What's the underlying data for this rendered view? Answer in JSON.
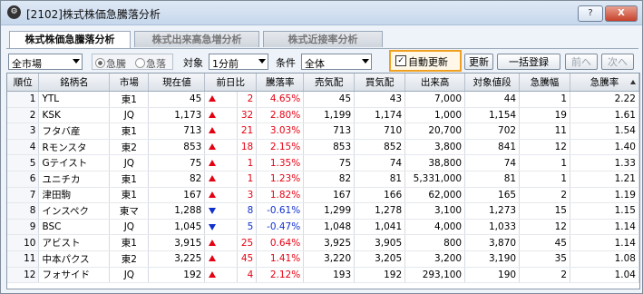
{
  "window": {
    "title": "[2102]株式株価急騰落分析",
    "help_label": "?",
    "close_label": "X"
  },
  "tabs": [
    {
      "label": "株式株価急騰落分析",
      "active": true
    },
    {
      "label": "株式出来高急増分析",
      "active": false
    },
    {
      "label": "株式近接率分析",
      "active": false
    }
  ],
  "toolbar": {
    "market_select": "全市場",
    "radio_rise": "急騰",
    "radio_fall": "急落",
    "target_label": "対象",
    "target_select": "1分前",
    "condition_label": "条件",
    "condition_select": "全体",
    "auto_update_label": "自動更新",
    "auto_update_checked": true,
    "update_button": "更新",
    "register_all_button": "一括登録",
    "prev_button": "前へ",
    "next_button": "次へ"
  },
  "table": {
    "headers": [
      "順位",
      "銘柄名",
      "市場",
      "現在値",
      "前日比",
      "",
      "騰落率",
      "売気配",
      "買気配",
      "出来高",
      "対象値段",
      "急騰幅",
      "急騰率"
    ],
    "rows": [
      {
        "rank": "1",
        "name": "YTL",
        "market": "東1",
        "price": "45",
        "dir": "up",
        "change": "2",
        "rate": "4.65%",
        "ask": "45",
        "bid": "43",
        "volume": "7,000",
        "target_price": "44",
        "width": "1",
        "jump_rate": "2.22"
      },
      {
        "rank": "2",
        "name": "KSK",
        "market": "JQ",
        "price": "1,173",
        "dir": "up",
        "change": "32",
        "rate": "2.80%",
        "ask": "1,199",
        "bid": "1,174",
        "volume": "1,000",
        "target_price": "1,154",
        "width": "19",
        "jump_rate": "1.61"
      },
      {
        "rank": "3",
        "name": "フタバ産",
        "market": "東1",
        "price": "713",
        "dir": "up",
        "change": "21",
        "rate": "3.03%",
        "ask": "713",
        "bid": "710",
        "volume": "20,700",
        "target_price": "702",
        "width": "11",
        "jump_rate": "1.54"
      },
      {
        "rank": "4",
        "name": "Rモンスタ",
        "market": "東2",
        "price": "853",
        "dir": "up",
        "change": "18",
        "rate": "2.15%",
        "ask": "853",
        "bid": "852",
        "volume": "3,800",
        "target_price": "841",
        "width": "12",
        "jump_rate": "1.40"
      },
      {
        "rank": "5",
        "name": "Gテイスト",
        "market": "JQ",
        "price": "75",
        "dir": "up",
        "change": "1",
        "rate": "1.35%",
        "ask": "75",
        "bid": "74",
        "volume": "38,800",
        "target_price": "74",
        "width": "1",
        "jump_rate": "1.33"
      },
      {
        "rank": "6",
        "name": "ユニチカ",
        "market": "東1",
        "price": "82",
        "dir": "up",
        "change": "1",
        "rate": "1.23%",
        "ask": "82",
        "bid": "81",
        "volume": "5,331,000",
        "target_price": "81",
        "width": "1",
        "jump_rate": "1.21"
      },
      {
        "rank": "7",
        "name": "津田駒",
        "market": "東1",
        "price": "167",
        "dir": "up",
        "change": "3",
        "rate": "1.82%",
        "ask": "167",
        "bid": "166",
        "volume": "62,000",
        "target_price": "165",
        "width": "2",
        "jump_rate": "1.19"
      },
      {
        "rank": "8",
        "name": "インスペク",
        "market": "東マ",
        "price": "1,288",
        "dir": "down",
        "change": "8",
        "rate": "-0.61%",
        "ask": "1,299",
        "bid": "1,278",
        "volume": "3,100",
        "target_price": "1,273",
        "width": "15",
        "jump_rate": "1.15"
      },
      {
        "rank": "9",
        "name": "BSC",
        "market": "JQ",
        "price": "1,045",
        "dir": "down",
        "change": "5",
        "rate": "-0.47%",
        "ask": "1,048",
        "bid": "1,041",
        "volume": "4,000",
        "target_price": "1,033",
        "width": "12",
        "jump_rate": "1.14"
      },
      {
        "rank": "10",
        "name": "アビスト",
        "market": "東1",
        "price": "3,915",
        "dir": "up",
        "change": "25",
        "rate": "0.64%",
        "ask": "3,925",
        "bid": "3,905",
        "volume": "800",
        "target_price": "3,870",
        "width": "45",
        "jump_rate": "1.14"
      },
      {
        "rank": "11",
        "name": "中本パクス",
        "market": "東2",
        "price": "3,225",
        "dir": "up",
        "change": "45",
        "rate": "1.41%",
        "ask": "3,220",
        "bid": "3,205",
        "volume": "3,200",
        "target_price": "3,190",
        "width": "35",
        "jump_rate": "1.08"
      },
      {
        "rank": "12",
        "name": "フォサイド",
        "market": "JQ",
        "price": "192",
        "dir": "up",
        "change": "4",
        "rate": "2.12%",
        "ask": "193",
        "bid": "192",
        "volume": "293,100",
        "target_price": "190",
        "width": "2",
        "jump_rate": "1.04"
      }
    ]
  },
  "colors": {
    "up": "#e60012",
    "down": "#1030d0",
    "highlight": "#f0a020"
  }
}
